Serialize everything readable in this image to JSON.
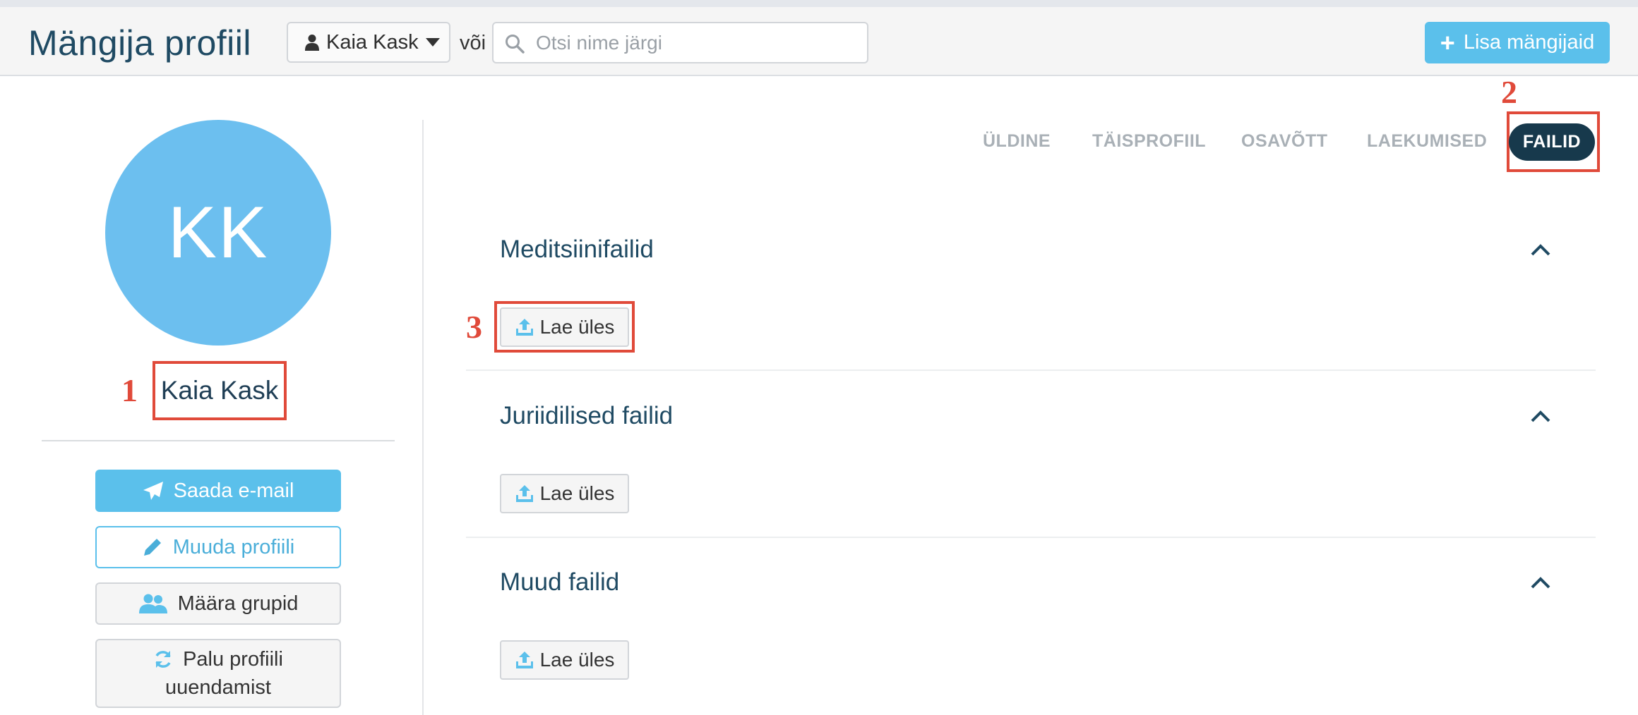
{
  "header": {
    "title": "Mängija profiil",
    "player_select": "Kaia Kask",
    "or_text": "või",
    "search_placeholder": "Otsi nime järgi",
    "add_button": "Lisa mängijaid"
  },
  "profile": {
    "initials": "KK",
    "name": "Kaia Kask",
    "avatar_color": "#6cbfef"
  },
  "actions": {
    "email": "Saada e-mail",
    "edit": "Muuda profiili",
    "groups": "Määra grupid",
    "renew_line1": "Palu profiili",
    "renew_line2": "uuendamist"
  },
  "tabs": [
    {
      "label": "ÜLDINE"
    },
    {
      "label": "TÄISPROFIIL"
    },
    {
      "label": "OSAVÕTT"
    },
    {
      "label": "LAEKUMISED"
    },
    {
      "label": "FAILID",
      "active": true
    }
  ],
  "sections": [
    {
      "title": "Meditsiinifailid",
      "upload_label": "Lae üles"
    },
    {
      "title": "Juriidilised failid",
      "upload_label": "Lae üles"
    },
    {
      "title": "Muud failid",
      "upload_label": "Lae üles"
    }
  ],
  "annotations": {
    "marker_1": "1",
    "marker_2": "2",
    "marker_3": "3",
    "color": "#e04a3a"
  },
  "colors": {
    "accent": "#5bc0eb",
    "active_tab": "#17394c",
    "title": "#1f4a63"
  }
}
